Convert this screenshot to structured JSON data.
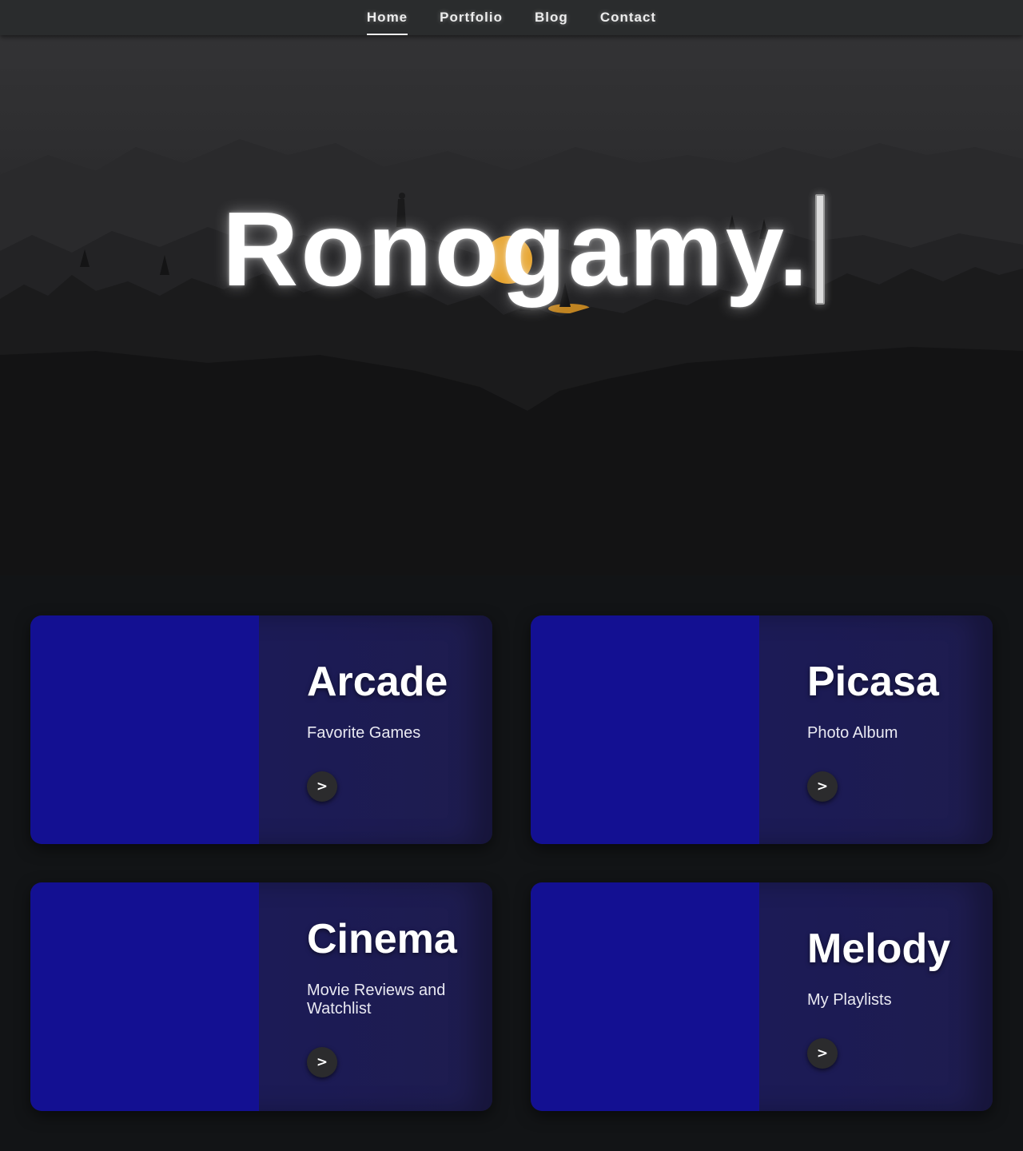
{
  "nav": {
    "items": [
      {
        "label": "Home",
        "active": true
      },
      {
        "label": "Portfolio",
        "active": false
      },
      {
        "label": "Blog",
        "active": false
      },
      {
        "label": "Contact",
        "active": false
      }
    ]
  },
  "hero": {
    "title": "Ronogamy.",
    "caret_icon": "text-cursor-icon",
    "background_icon": "mountain-landscape-illustration"
  },
  "cards": [
    {
      "title": "Arcade",
      "subtitle": "Favorite Games",
      "button_icon": "chevron-right-icon",
      "button_glyph": ">"
    },
    {
      "title": "Picasa",
      "subtitle": "Photo Album",
      "button_icon": "chevron-right-icon",
      "button_glyph": ">"
    },
    {
      "title": "Cinema",
      "subtitle": "Movie Reviews and Watchlist",
      "button_icon": "chevron-right-icon",
      "button_glyph": ">"
    },
    {
      "title": "Melody",
      "subtitle": "My Playlists",
      "button_icon": "chevron-right-icon",
      "button_glyph": ">"
    }
  ],
  "colors": {
    "nav_bg": "#2a2c2d",
    "page_bg": "#121416",
    "card_bg": "#1b1a5a",
    "card_image": "#131092",
    "moon": "#e6a22a"
  }
}
